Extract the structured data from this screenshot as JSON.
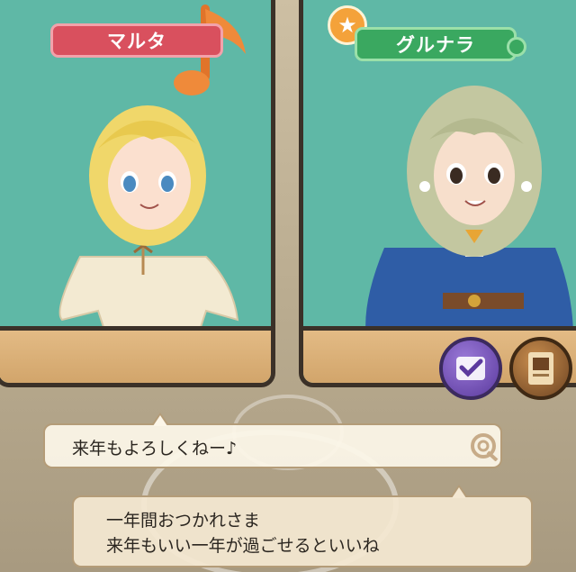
{
  "characters": {
    "left": {
      "name": "マルタ"
    },
    "right": {
      "name": "グルナラ"
    }
  },
  "badges": {
    "star_icon": "star-icon",
    "note_icon": "music-note-icon"
  },
  "buttons": {
    "confirm_icon": "checkmark-icon",
    "card_icon": "card-icon"
  },
  "dialogue": {
    "first": "来年もよろしくねー♪",
    "second_line1": "一年間おつかれさま",
    "second_line2": "来年もいい一年が過ごせるといいね"
  },
  "colors": {
    "pink_tag": "#d9505e",
    "green_tag": "#3aa860",
    "panel_bg": "#5fb8a6",
    "star": "#f4a23a"
  }
}
